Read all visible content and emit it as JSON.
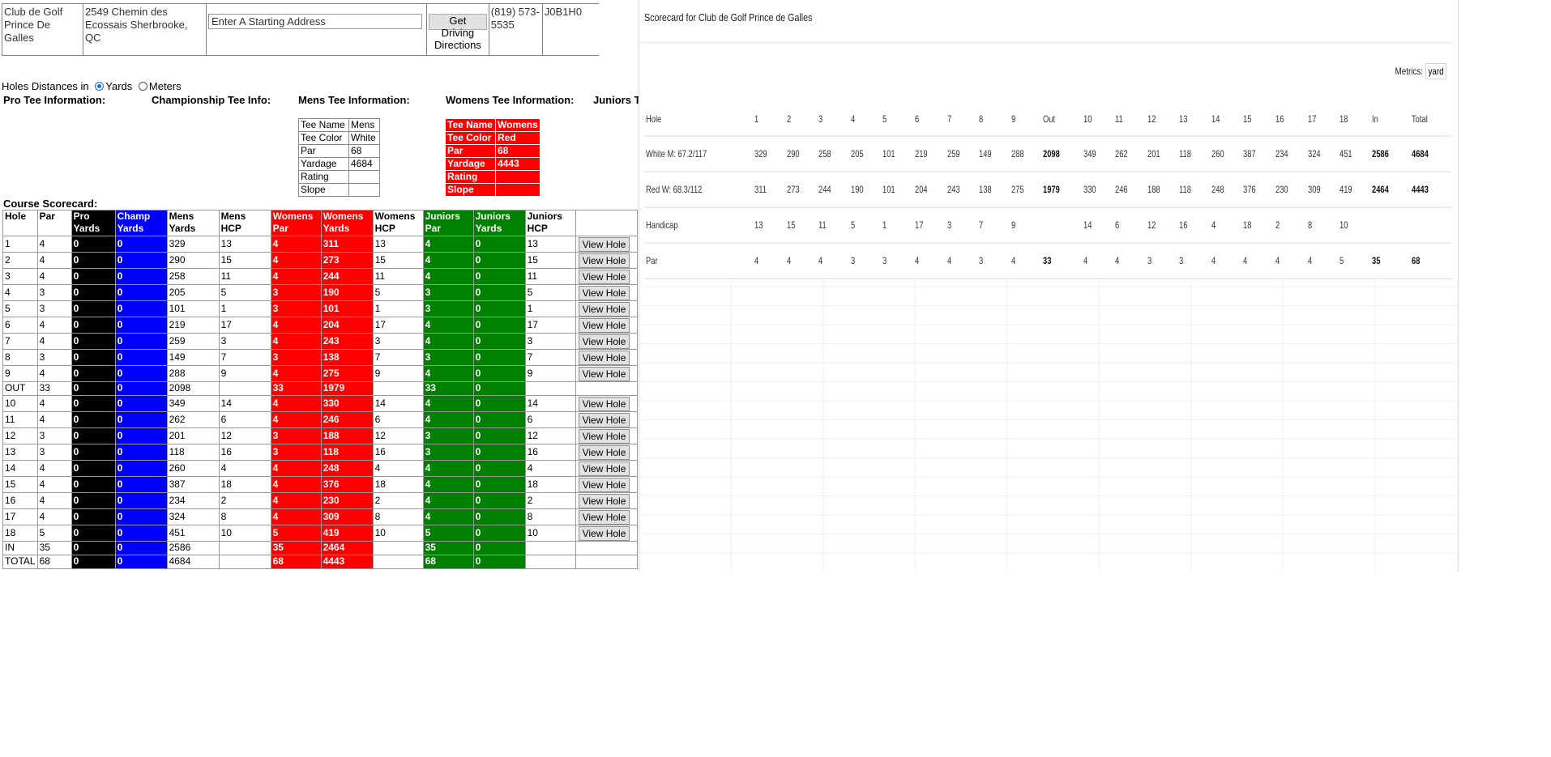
{
  "info": {
    "course_name": "Club de Golf Prince De Galles",
    "address": "2549 Chemin des Ecossais Sherbrooke, QC",
    "address_placeholder": "Enter A Starting Address",
    "directions_label": "Get Driving Directions",
    "phone": "(819) 573-5535",
    "postal": "J0B1H0"
  },
  "distances": {
    "label": "Holes Distances in",
    "yards": "Yards",
    "meters": "Meters",
    "selected": "Yards"
  },
  "tee_headings": {
    "pro": "Pro Tee Information:",
    "championship": "Championship Tee Info:",
    "mens": "Mens Tee Information:",
    "womens": "Womens Tee Information:",
    "juniors": "Juniors Tee Information:"
  },
  "mens_tee": [
    [
      "Tee Name",
      "Mens"
    ],
    [
      "Tee Color",
      "White"
    ],
    [
      "Par",
      "68"
    ],
    [
      "Yardage",
      "4684"
    ],
    [
      "Rating",
      ""
    ],
    [
      "Slope",
      ""
    ]
  ],
  "womens_tee": [
    [
      "Tee Name",
      "Womens"
    ],
    [
      "Tee Color",
      "Red"
    ],
    [
      "Par",
      "68"
    ],
    [
      "Yardage",
      "4443"
    ],
    [
      "Rating",
      ""
    ],
    [
      "Slope",
      ""
    ]
  ],
  "course_label": "Course Scorecard:",
  "scorecard": {
    "headers": [
      "Hole",
      "Par",
      "Pro Yards",
      "Champ Yards",
      "Mens Yards",
      "Mens HCP",
      "Womens Par",
      "Womens Yards",
      "Womens HCP",
      "Juniors Par",
      "Juniors Yards",
      "Juniors HCP",
      ""
    ],
    "view_label": "View Hole",
    "rows": [
      [
        "1",
        "4",
        "0",
        "0",
        "329",
        "13",
        "4",
        "311",
        "13",
        "4",
        "0",
        "13"
      ],
      [
        "2",
        "4",
        "0",
        "0",
        "290",
        "15",
        "4",
        "273",
        "15",
        "4",
        "0",
        "15"
      ],
      [
        "3",
        "4",
        "0",
        "0",
        "258",
        "11",
        "4",
        "244",
        "11",
        "4",
        "0",
        "11"
      ],
      [
        "4",
        "3",
        "0",
        "0",
        "205",
        "5",
        "3",
        "190",
        "5",
        "3",
        "0",
        "5"
      ],
      [
        "5",
        "3",
        "0",
        "0",
        "101",
        "1",
        "3",
        "101",
        "1",
        "3",
        "0",
        "1"
      ],
      [
        "6",
        "4",
        "0",
        "0",
        "219",
        "17",
        "4",
        "204",
        "17",
        "4",
        "0",
        "17"
      ],
      [
        "7",
        "4",
        "0",
        "0",
        "259",
        "3",
        "4",
        "243",
        "3",
        "4",
        "0",
        "3"
      ],
      [
        "8",
        "3",
        "0",
        "0",
        "149",
        "7",
        "3",
        "138",
        "7",
        "3",
        "0",
        "7"
      ],
      [
        "9",
        "4",
        "0",
        "0",
        "288",
        "9",
        "4",
        "275",
        "9",
        "4",
        "0",
        "9"
      ],
      [
        "OUT",
        "33",
        "0",
        "0",
        "2098",
        "",
        "33",
        "1979",
        "",
        "33",
        "0",
        ""
      ],
      [
        "10",
        "4",
        "0",
        "0",
        "349",
        "14",
        "4",
        "330",
        "14",
        "4",
        "0",
        "14"
      ],
      [
        "11",
        "4",
        "0",
        "0",
        "262",
        "6",
        "4",
        "246",
        "6",
        "4",
        "0",
        "6"
      ],
      [
        "12",
        "3",
        "0",
        "0",
        "201",
        "12",
        "3",
        "188",
        "12",
        "3",
        "0",
        "12"
      ],
      [
        "13",
        "3",
        "0",
        "0",
        "118",
        "16",
        "3",
        "118",
        "16",
        "3",
        "0",
        "16"
      ],
      [
        "14",
        "4",
        "0",
        "0",
        "260",
        "4",
        "4",
        "248",
        "4",
        "4",
        "0",
        "4"
      ],
      [
        "15",
        "4",
        "0",
        "0",
        "387",
        "18",
        "4",
        "376",
        "18",
        "4",
        "0",
        "18"
      ],
      [
        "16",
        "4",
        "0",
        "0",
        "234",
        "2",
        "4",
        "230",
        "2",
        "4",
        "0",
        "2"
      ],
      [
        "17",
        "4",
        "0",
        "0",
        "324",
        "8",
        "4",
        "309",
        "8",
        "4",
        "0",
        "8"
      ],
      [
        "18",
        "5",
        "0",
        "0",
        "451",
        "10",
        "5",
        "419",
        "10",
        "5",
        "0",
        "10"
      ],
      [
        "IN",
        "35",
        "0",
        "0",
        "2586",
        "",
        "35",
        "2464",
        "",
        "35",
        "0",
        ""
      ],
      [
        "TOTAL",
        "68",
        "0",
        "0",
        "4684",
        "",
        "68",
        "4443",
        "",
        "68",
        "0",
        ""
      ]
    ]
  },
  "right_card": {
    "title": "Scorecard for Club de Golf Prince de Galles",
    "metrics_label": "Metrics:",
    "metrics_value": "yards",
    "header": [
      "Hole",
      "1",
      "2",
      "3",
      "4",
      "5",
      "6",
      "7",
      "8",
      "9",
      "Out",
      "10",
      "11",
      "12",
      "13",
      "14",
      "15",
      "16",
      "17",
      "18",
      "In",
      "Total"
    ],
    "rows": [
      [
        "White M: 67.2/117",
        "329",
        "290",
        "258",
        "205",
        "101",
        "219",
        "259",
        "149",
        "288",
        "2098",
        "349",
        "262",
        "201",
        "118",
        "260",
        "387",
        "234",
        "324",
        "451",
        "2586",
        "4684"
      ],
      [
        "Red W: 68.3/112",
        "311",
        "273",
        "244",
        "190",
        "101",
        "204",
        "243",
        "138",
        "275",
        "1979",
        "330",
        "246",
        "188",
        "118",
        "248",
        "376",
        "230",
        "309",
        "419",
        "2464",
        "4443"
      ],
      [
        "Handicap",
        "13",
        "15",
        "11",
        "5",
        "1",
        "17",
        "3",
        "7",
        "9",
        "",
        "14",
        "6",
        "12",
        "16",
        "4",
        "18",
        "2",
        "8",
        "10",
        "",
        ""
      ],
      [
        "Par",
        "4",
        "4",
        "4",
        "3",
        "3",
        "4",
        "4",
        "3",
        "4",
        "33",
        "4",
        "4",
        "3",
        "3",
        "4",
        "4",
        "4",
        "4",
        "5",
        "35",
        "68"
      ]
    ]
  }
}
